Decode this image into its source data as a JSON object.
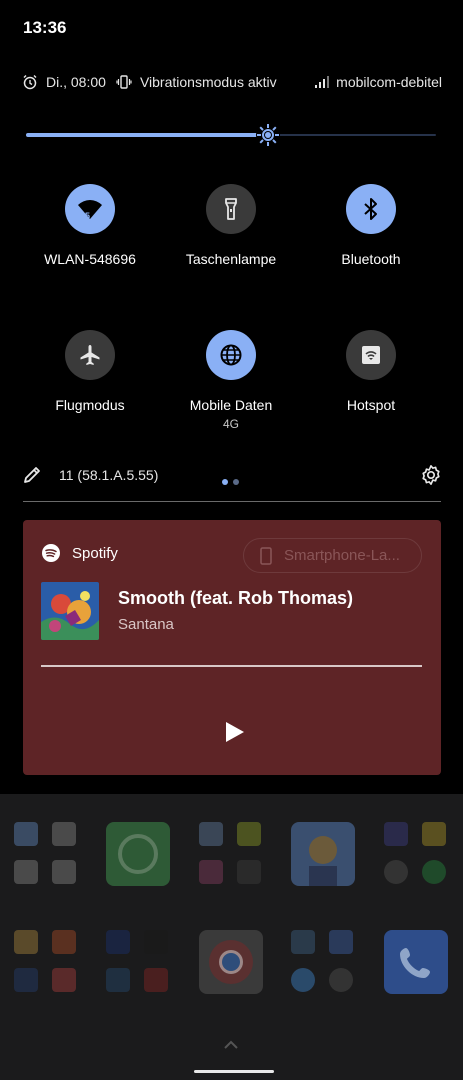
{
  "status_bar": {
    "time": "13:36"
  },
  "info_row": {
    "alarm": "Di., 08:00",
    "vibration": "Vibrationsmodus aktiv",
    "carrier": "mobilcom-debitel"
  },
  "brightness": {
    "level_percent": 59
  },
  "tiles": [
    {
      "label": "WLAN-548696",
      "sub": "",
      "icon": "wifi-icon",
      "state": "on"
    },
    {
      "label": "Taschenlampe",
      "sub": "",
      "icon": "flashlight-icon",
      "state": "off"
    },
    {
      "label": "Bluetooth",
      "sub": "",
      "icon": "bluetooth-icon",
      "state": "on"
    },
    {
      "label": "Flugmodus",
      "sub": "",
      "icon": "airplane-icon",
      "state": "off"
    },
    {
      "label": "Mobile Daten",
      "sub": "4G",
      "icon": "globe-icon",
      "state": "on"
    },
    {
      "label": "Hotspot",
      "sub": "",
      "icon": "hotspot-icon",
      "state": "off"
    }
  ],
  "footer": {
    "build": "11 (58.1.A.5.55)",
    "pages": 2,
    "current_page": 1
  },
  "media": {
    "app": "Spotify",
    "output_device": "Smartphone-La...",
    "title": "Smooth (feat. Rob Thomas)",
    "artist": "Santana",
    "play_icon": "play-icon"
  },
  "colors": {
    "accent": "#8ab0f5",
    "tile_off": "#3a3a3a",
    "media_bg": "#5e2426",
    "home_bg": "#1b1b1c"
  }
}
